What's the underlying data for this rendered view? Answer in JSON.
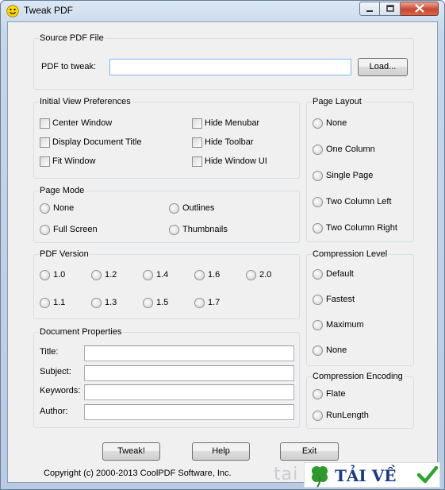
{
  "window": {
    "title": "Tweak PDF"
  },
  "source": {
    "group_label": "Source PDF File",
    "pdf_label": "PDF to tweak:",
    "pdf_value": "",
    "load_button": "Load..."
  },
  "initial_view": {
    "group_label": "Initial View Preferences",
    "options": [
      "Center Window",
      "Display Document Title",
      "Fit Window",
      "Hide Menubar",
      "Hide Toolbar",
      "Hide Window UI"
    ]
  },
  "page_layout": {
    "group_label": "Page Layout",
    "options": [
      "None",
      "One Column",
      "Single Page",
      "Two Column Left",
      "Two Column Right"
    ]
  },
  "page_mode": {
    "group_label": "Page Mode",
    "options": [
      "None",
      "Outlines",
      "Full Screen",
      "Thumbnails"
    ]
  },
  "pdf_version": {
    "group_label": "PDF Version",
    "options": [
      "1.0",
      "1.2",
      "1.4",
      "1.6",
      "2.0",
      "1.1",
      "1.3",
      "1.5",
      "1.7"
    ]
  },
  "compression_level": {
    "group_label": "Compression Level",
    "options": [
      "Default",
      "Fastest",
      "Maximum",
      "None"
    ]
  },
  "doc_props": {
    "group_label": "Document Properties",
    "title_label": "Title:",
    "subject_label": "Subject:",
    "keywords_label": "Keywords:",
    "author_label": "Author:",
    "title_value": "",
    "subject_value": "",
    "keywords_value": "",
    "author_value": ""
  },
  "compression_encoding": {
    "group_label": "Compression Encoding",
    "options": [
      "Flate",
      "RunLength"
    ]
  },
  "buttons": {
    "tweak": "Tweak!",
    "help": "Help",
    "exit": "Exit"
  },
  "footer": {
    "copyright": "Copyright (c) 2000-2013 CoolPDF Software, Inc."
  },
  "watermark": {
    "faded": "tai",
    "text": "TẢI VỀ"
  },
  "colors": {
    "accent": "#7eb4ea",
    "close_button": "#c9462c",
    "watermark_text": "#1a3a8a"
  }
}
